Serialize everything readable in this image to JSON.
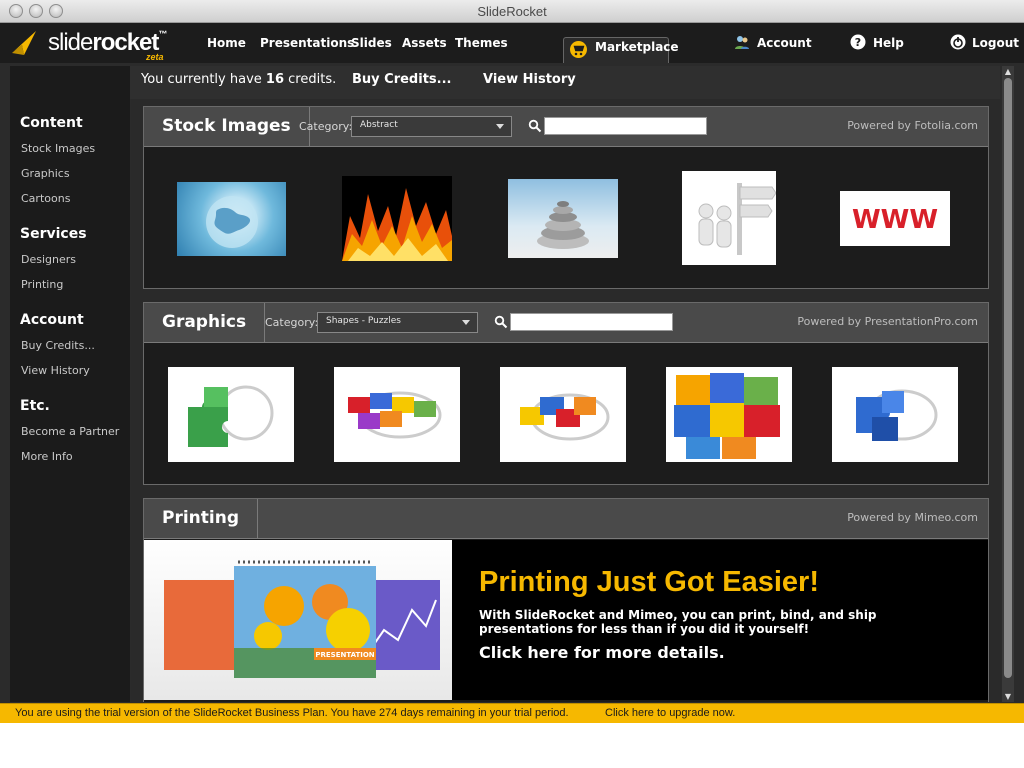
{
  "window": {
    "title": "SlideRocket"
  },
  "app": {
    "logo": {
      "slide": "slide",
      "rocket": "rocket",
      "zeta": "zeta",
      "trademark": "™"
    },
    "nav": {
      "home": "Home",
      "presentations": "Presentations",
      "slides": "Slides",
      "assets": "Assets",
      "themes": "Themes",
      "marketplace": "Marketplace",
      "account": "Account",
      "help": "Help",
      "logout": "Logout"
    },
    "credits": {
      "text_prefix": "You currently have",
      "count": "16",
      "text_suffix": "credits.",
      "buy": "Buy Credits...",
      "history": "View History"
    }
  },
  "sidebar": {
    "sections": [
      {
        "title": "Content",
        "items": [
          "Stock Images",
          "Graphics",
          "Cartoons"
        ]
      },
      {
        "title": "Services",
        "items": [
          "Designers",
          "Printing"
        ]
      },
      {
        "title": "Account",
        "items": [
          "Buy Credits...",
          "View History"
        ]
      },
      {
        "title": "Etc.",
        "items": [
          "Become a Partner",
          "More Info"
        ]
      }
    ]
  },
  "panels": {
    "stock": {
      "title": "Stock Images",
      "category_label": "Category:",
      "category_value": "Abstract",
      "powered_by": "Powered by Fotolia.com"
    },
    "graphics": {
      "title": "Graphics",
      "category_label": "Category:",
      "category_value": "Shapes - Puzzles",
      "powered_by": "Powered by PresentationPro.com"
    },
    "printing": {
      "title": "Printing",
      "powered_by": "Powered by Mimeo.com",
      "banner_title": "Printing Just Got Easier!",
      "banner_text": "With SlideRocket and Mimeo, you can print, bind, and ship presentations for less than if you did it yourself!",
      "banner_link": "Click here for more details.",
      "presentation_label": "PRESENTATION"
    }
  },
  "trial": {
    "message": "You are using the trial version of the SlideRocket Business Plan. You have 274 days remaining in your trial period.",
    "link": "Click here to upgrade now."
  },
  "colors": {
    "accent": "#f6b800",
    "background": "#2b2b2b",
    "panel_header": "#4a4a4a"
  }
}
